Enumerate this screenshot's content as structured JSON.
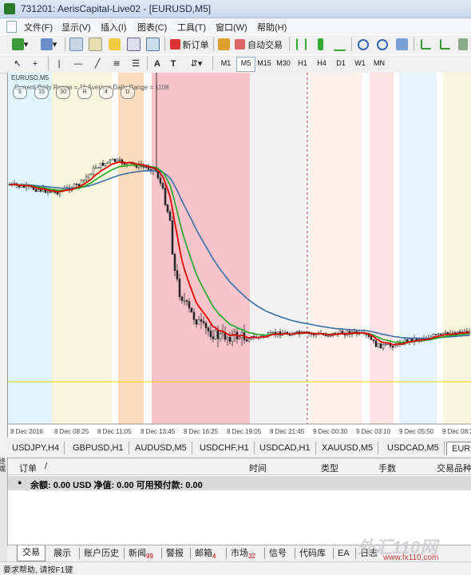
{
  "window": {
    "title": "731201: AerisCapital-Live02 - [EURUSD,M5]"
  },
  "menu": [
    "文件(F)",
    "显示(V)",
    "插入(I)",
    "图表(C)",
    "工具(T)",
    "窗口(W)",
    "帮助(H)"
  ],
  "toolbar": {
    "new_order_label": "新订单",
    "auto_trade_label": "自动交易"
  },
  "timeframes": [
    "M1",
    "M5",
    "M15",
    "M30",
    "H1",
    "H4",
    "D1",
    "W1",
    "MN"
  ],
  "active_timeframe": "M5",
  "chart": {
    "symbol_label": "EURUSD,M5",
    "info_text": "Current Daily Range = 11   Average Daily Range = 1108",
    "session_buttons": [
      "5",
      "15",
      "30",
      "H",
      "4",
      "D"
    ],
    "x_labels": [
      "8 Dec 2016",
      "8 Dec 08:25",
      "8 Dec 11:05",
      "8 Dec 13:45",
      "8 Dec 16:25",
      "8 Dec 19:05",
      "8 Dec 21:45",
      "9 Dec 00:30",
      "9 Dec 03:10",
      "9 Dec 05:50",
      "9 Dec 08:30"
    ],
    "colors": {
      "red_ma": "#e00000",
      "green_ma": "#1fa81f",
      "blue_ma": "#3a6ea5",
      "level_line": "#f0d000"
    }
  },
  "symbol_tabs": [
    "USDJPY,H4",
    "GBPUSD,H1",
    "AUDUSD,M5",
    "USDCHF,H1",
    "USDCAD,H1",
    "XAUUSD,M5",
    "USDCAD,M5",
    "EURU"
  ],
  "terminal": {
    "columns": [
      "订单",
      "/",
      "时间",
      "类型",
      "手数",
      "交易品种"
    ],
    "balance_text": "余额: 0.00 USD  净值: 0.00  可用预付款: 0.00",
    "side_label": "终端"
  },
  "bottom_tabs": [
    {
      "label": "交易",
      "badge": ""
    },
    {
      "label": "展示",
      "badge": ""
    },
    {
      "label": "账户历史",
      "badge": ""
    },
    {
      "label": "新闻",
      "badge": "99"
    },
    {
      "label": "警报",
      "badge": ""
    },
    {
      "label": "邮箱",
      "badge": "4"
    },
    {
      "label": "市场",
      "badge": "32"
    },
    {
      "label": "信号",
      "badge": ""
    },
    {
      "label": "代码库",
      "badge": ""
    },
    {
      "label": "EA",
      "badge": ""
    },
    {
      "label": "日志",
      "badge": ""
    }
  ],
  "status_text": "要求帮助, 请按F1键",
  "watermark": {
    "main": "外汇110网",
    "url": "www.fx110.com"
  }
}
